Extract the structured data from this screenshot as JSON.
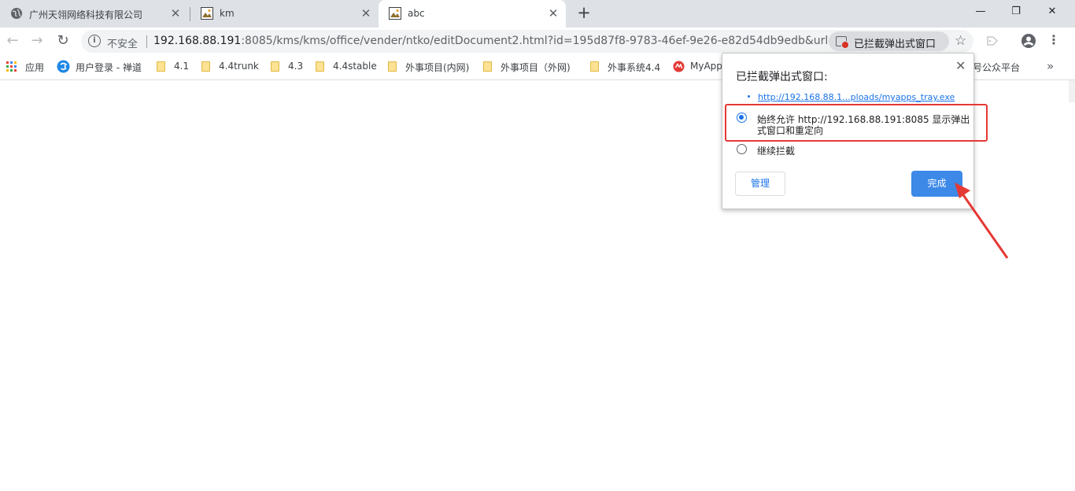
{
  "tabs": [
    {
      "title": "广州天翎网络科技有限公司",
      "icon": "globe-icon",
      "active": false
    },
    {
      "title": "km",
      "icon": "picture-icon",
      "active": false
    },
    {
      "title": "abc",
      "icon": "picture-icon",
      "active": true
    }
  ],
  "tab_close_glyph": "✕",
  "new_tab_glyph": "+",
  "window_controls": {
    "minimize": "—",
    "maximize": "❐",
    "close": "✕"
  },
  "toolbar": {
    "back_glyph": "←",
    "forward_glyph": "→",
    "reload_glyph": "↻",
    "security_label": "不安全",
    "url_host": "192.168.88.191",
    "url_rest": ":8085/kms/kms/office/vender/ntko/editDocument2.html?id=195d87f8-9783-46ef-9e26-e82d54db9edb&url=...",
    "blocked_chip_label": "已拦截弹出式窗口",
    "star_glyph": "☆",
    "menu_glyph": "⋮"
  },
  "bookmarks": [
    {
      "label": "应用",
      "icon": "apps-grid-icon"
    },
    {
      "label": "用户登录 - 禅道",
      "icon": "zentao-icon"
    },
    {
      "label": "4.1",
      "icon": "folder-icon"
    },
    {
      "label": "4.4trunk",
      "icon": "folder-icon"
    },
    {
      "label": "4.3",
      "icon": "folder-icon"
    },
    {
      "label": "4.4stable",
      "icon": "folder-icon"
    },
    {
      "label": "外事项目(内网)",
      "icon": "folder-icon"
    },
    {
      "label": "外事项目（外网)",
      "icon": "folder-icon"
    },
    {
      "label": "外事系统4.4",
      "icon": "folder-icon"
    },
    {
      "label": "MyApp",
      "icon": "myapp-icon"
    },
    {
      "label": "号公众平台",
      "icon": "none"
    }
  ],
  "bookmarks_more_glyph": "»",
  "popup": {
    "title": "已拦截弹出式窗口:",
    "close_glyph": "✕",
    "blocked_link": "http://192.168.88.1...ploads/myapps_tray.exe",
    "option_allow": "始终允许 http://192.168.88.191:8085 显示弹出式窗口和重定向",
    "option_allow_line1": "始终允许 http://192.168.88.191:8085 显示弹出",
    "option_allow_line2": "式窗口和重定向",
    "option_block": "继续拦截",
    "selected_option": "allow",
    "manage_label": "管理",
    "done_label": "完成"
  },
  "colors": {
    "accent": "#1a73e8",
    "done_button": "#3c89e8",
    "annotation_red": "#e53935",
    "tabstrip_bg": "#dee1e6",
    "omnibox_bg": "#f1f3f4"
  }
}
